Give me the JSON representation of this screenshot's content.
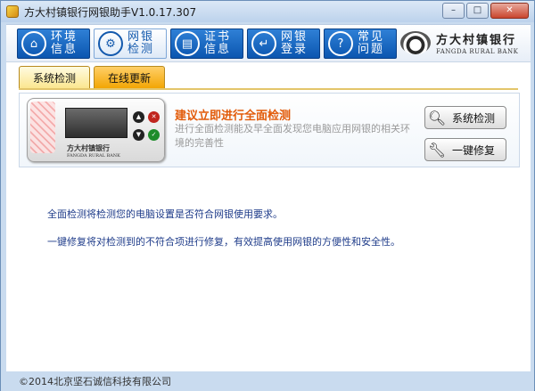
{
  "window": {
    "title": "方大村镇银行网银助手V1.0.17.307",
    "min_label": "–",
    "max_label": "□",
    "close_label": "✕"
  },
  "nav": {
    "items": [
      {
        "label": "环境信息",
        "icon": "home-icon",
        "glyph": "⌂"
      },
      {
        "label": "网银检测",
        "icon": "cog-icon",
        "glyph": "⚙"
      },
      {
        "label": "证书信息",
        "icon": "certificate-icon",
        "glyph": "▤"
      },
      {
        "label": "网银登录",
        "icon": "login-icon",
        "glyph": "↵"
      },
      {
        "label": "常见问题",
        "icon": "help-icon",
        "glyph": "?"
      }
    ]
  },
  "bank": {
    "name_cn": "方大村镇银行",
    "name_en": "FANGDA RURAL BANK"
  },
  "tabs": [
    {
      "label": "系统检测"
    },
    {
      "label": "在线更新"
    }
  ],
  "panel": {
    "title": "建议立即进行全面检测",
    "description": "进行全面检测能及早全面发现您电脑应用网银的相关环境的完善性",
    "device_label": "方大村镇银行",
    "device_sublabel": "FANGDA RURAL BANK",
    "check_button": "系统检测",
    "fix_button": "一键修复"
  },
  "info": {
    "line1": "全面检测将检测您的电脑设置是否符合网银使用要求。",
    "line2": "一键修复将对检测到的不符合项进行修复，有效提高使用网银的方便性和安全性。"
  },
  "footer": {
    "copyright": "©2014北京坚石诚信科技有限公司"
  },
  "colors": {
    "nav_blue": "#0b56b0",
    "tab_active": "#fbe58c",
    "tab_inactive": "#f2a400",
    "title_orange": "#e25a08",
    "info_blue": "#1f3c8a"
  }
}
